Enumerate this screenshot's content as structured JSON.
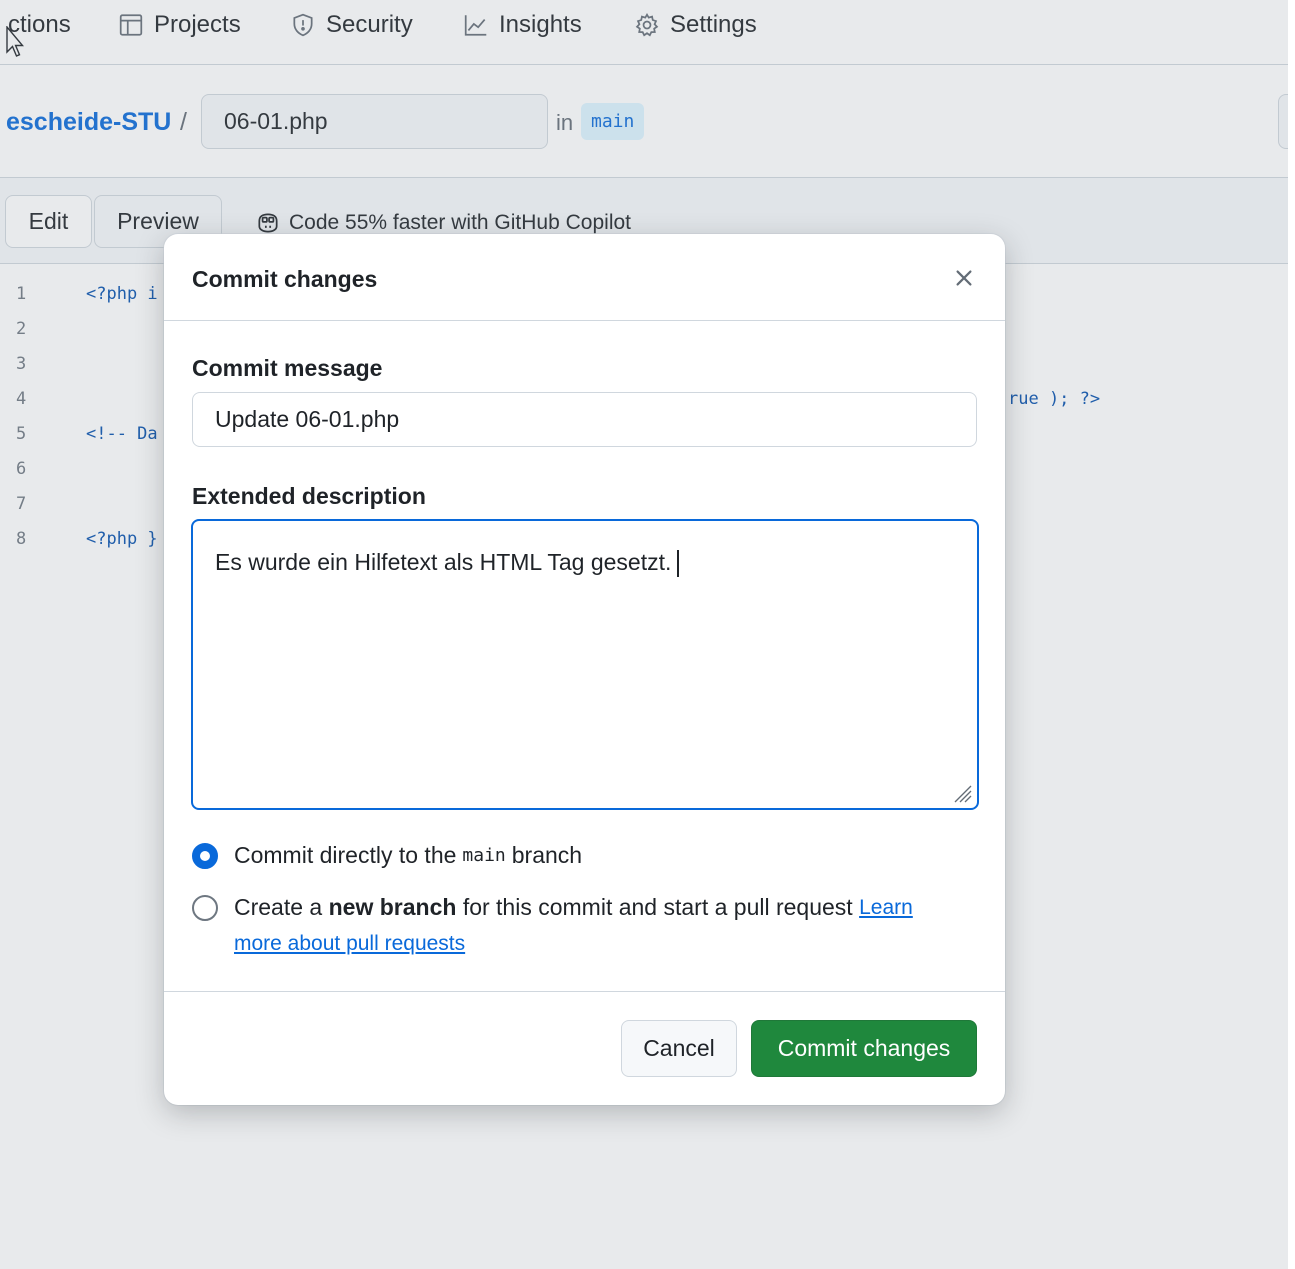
{
  "nav": {
    "items": [
      {
        "label": "ctions",
        "icon": "play-icon"
      },
      {
        "label": "Projects",
        "icon": "table-icon"
      },
      {
        "label": "Security",
        "icon": "shield-icon"
      },
      {
        "label": "Insights",
        "icon": "graph-icon"
      },
      {
        "label": "Settings",
        "icon": "gear-icon"
      }
    ]
  },
  "breadcrumb": {
    "repo": "escheide-STU",
    "separator": "/",
    "filename": "06-01.php",
    "in_label": "in",
    "branch": "main"
  },
  "editor_tabs": {
    "edit": "Edit",
    "preview": "Preview",
    "copilot_promo": "Code 55% faster with GitHub Copilot"
  },
  "code": {
    "lines": [
      {
        "num": "1",
        "text": "<?php i",
        "right": ""
      },
      {
        "num": "2",
        "text": "",
        "right": ""
      },
      {
        "num": "3",
        "text": "",
        "right": ""
      },
      {
        "num": "4",
        "text": "",
        "right": "rue ); ?>"
      },
      {
        "num": "5",
        "text": "<!-- Da",
        "right": ""
      },
      {
        "num": "6",
        "text": "",
        "right": ""
      },
      {
        "num": "7",
        "text": "",
        "right": ""
      },
      {
        "num": "8",
        "text": "<?php }",
        "right": ""
      }
    ]
  },
  "dialog": {
    "title": "Commit changes",
    "commit_message_label": "Commit message",
    "commit_message_value": "Update 06-01.php",
    "extended_description_label": "Extended description",
    "extended_description_value": "Es wurde ein Hilfetext als HTML Tag gesetzt.",
    "option_direct_prefix": "Commit directly to the",
    "option_direct_branch": "main",
    "option_direct_suffix": "branch",
    "option_new_prefix": "Create a",
    "option_new_bold": "new branch",
    "option_new_suffix": "for this commit and start a pull request",
    "option_new_link_1": "Learn",
    "option_new_link_2": "more about pull requests",
    "selected_option": "direct",
    "cancel_label": "Cancel",
    "commit_label": "Commit changes"
  },
  "colors": {
    "accent": "#0969da",
    "primary_button": "#1f883d",
    "border": "#d0d7de"
  }
}
